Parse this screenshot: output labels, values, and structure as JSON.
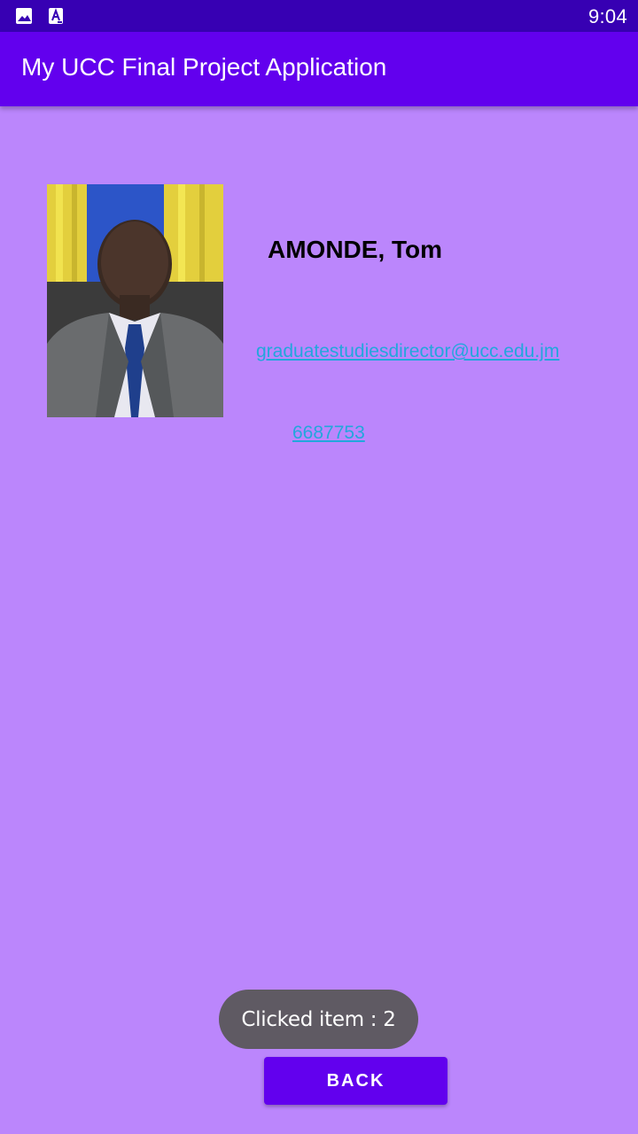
{
  "status_bar": {
    "time": "9:04",
    "icons": [
      "image-icon",
      "font-icon"
    ]
  },
  "app_bar": {
    "title": "My UCC Final Project Application"
  },
  "contact": {
    "photo_icon": "person-photo",
    "name": "AMONDE, Tom",
    "email": "graduatestudiesdirector@ucc.edu.jm",
    "phone": "6687753"
  },
  "toast": {
    "text": "Clicked item : 2"
  },
  "actions": {
    "back_label": "BACK"
  },
  "colors": {
    "status_bar": "#3700b3",
    "app_bar": "#6200ee",
    "background": "#bb86fc",
    "link": "#22a7dc",
    "toast": "#5f5a63"
  }
}
